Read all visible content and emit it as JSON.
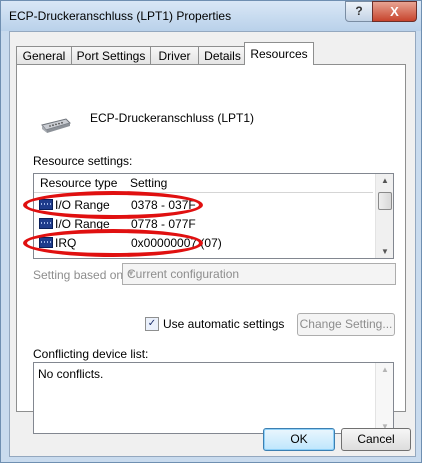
{
  "window": {
    "title": "ECP-Druckeranschluss (LPT1) Properties",
    "help_label": "?",
    "close_label": "X"
  },
  "tabs": [
    {
      "label": "General",
      "active": false
    },
    {
      "label": "Port Settings",
      "active": false
    },
    {
      "label": "Driver",
      "active": false
    },
    {
      "label": "Details",
      "active": false
    },
    {
      "label": "Resources",
      "active": true
    }
  ],
  "device": {
    "name": "ECP-Druckeranschluss (LPT1)",
    "icon": "port-icon"
  },
  "resource_settings": {
    "label": "Resource settings:",
    "columns": [
      "Resource type",
      "Setting"
    ],
    "rows": [
      {
        "type": "I/O Range",
        "setting": "0378 - 037F",
        "icon": "chip-icon"
      },
      {
        "type": "I/O Range",
        "setting": "0778 - 077F",
        "icon": "chip-icon"
      },
      {
        "type": "IRQ",
        "setting": "0x00000007 (07)",
        "icon": "chip-icon"
      }
    ]
  },
  "setting_based_on": {
    "label": "Setting based on:",
    "value": "Current configuration"
  },
  "automatic": {
    "label": "Use automatic settings",
    "checked": true
  },
  "change_setting_label": "Change Setting...",
  "conflicts": {
    "label": "Conflicting device list:",
    "text": "No conflicts."
  },
  "buttons": {
    "ok": "OK",
    "cancel": "Cancel"
  },
  "colors": {
    "title_bar": "#c9dbee",
    "close_button": "#c7442d",
    "highlight": "#e01010",
    "chip": "#1e3c8c"
  }
}
